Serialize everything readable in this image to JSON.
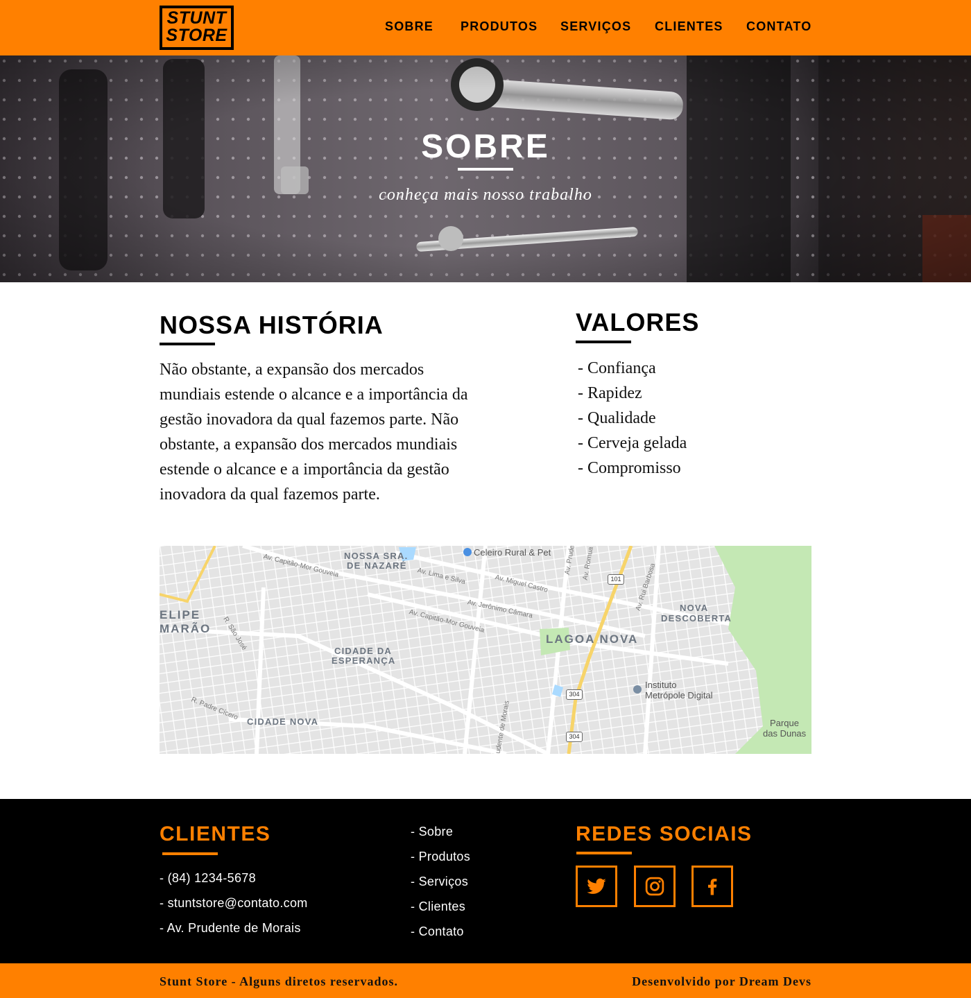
{
  "header": {
    "logo_line1": "STUNT",
    "logo_line2": "STORE",
    "nav": [
      "SOBRE",
      "PRODUTOS",
      "SERVIÇOS",
      "CLIENTES",
      "CONTATO"
    ]
  },
  "hero": {
    "title": "SOBRE",
    "subtitle": "conheça mais nosso trabalho"
  },
  "history": {
    "title": "NOSSA HISTÓRIA",
    "text": "Não obstante, a expansão dos mercados mundiais estende o alcance e a importância da gestão inovadora da qual fazemos parte. Não obstante, a expansão dos mercados mundiais estende o alcance e a importância da gestão inovadora da qual fazemos parte."
  },
  "values": {
    "title": "VALORES",
    "items": [
      "- Confiança",
      "- Rapidez",
      "- Qualidade",
      "- Cerveja gelada",
      "- Compromisso"
    ]
  },
  "map": {
    "neighborhoods": [
      "NOSSA SRA.",
      "DE NAZARÉ",
      "ELIPE",
      "MARÃO",
      "CIDADE DA",
      "ESPERANÇA",
      "CIDADE NOVA",
      "LAGOA NOVA",
      "NOVA",
      "DESCOBERTA"
    ],
    "pois": [
      "Celeiro Rural & Pet",
      "Instituto",
      "Metrópole Digital",
      "Parque",
      "das Dunas"
    ],
    "streets": [
      "Av. Capitão-Mor Gouveia",
      "Av. Lima e Silva",
      "Av. Miguel Castro",
      "Av. Jerônimo Câmara",
      "Av. Capitão-Mor Gouveia",
      "R. São José",
      "R. Padre Cícero",
      "udente de Morais",
      "Av. Prude",
      "Av. Romua",
      "Av. Rui Barbosa"
    ],
    "highways": [
      "101",
      "304",
      "304"
    ]
  },
  "footer": {
    "clients_title": "CLIENTES",
    "contacts": [
      "- (84) 1234-5678",
      "- stuntstore@contato.com",
      "- Av. Prudente de Morais"
    ],
    "links": [
      "- Sobre",
      "- Produtos",
      "- Serviços",
      "- Clientes",
      "- Contato"
    ],
    "social_title": "REDES SOCIAIS",
    "social_icons": [
      "twitter-icon",
      "instagram-icon",
      "facebook-icon"
    ],
    "copyright": "Stunt Store - Alguns diretos reservados.",
    "credit": "Desenvolvido por Dream Devs"
  },
  "colors": {
    "accent": "#ff8000",
    "footer_bg": "#000000",
    "map_bg": "#ececec",
    "park": "#c4e8b4"
  }
}
